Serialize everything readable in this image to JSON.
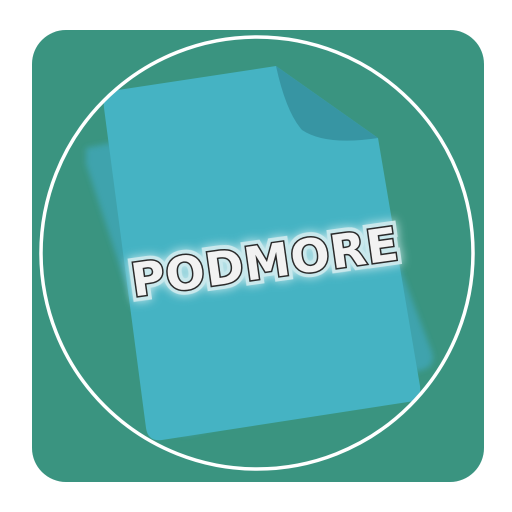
{
  "app": {
    "name": "PODMORE"
  },
  "icon": {
    "semantic": "document-file-icon",
    "colors": {
      "tile": "#3A9480",
      "ring": "#FFFFFF",
      "document": "#45B3C3",
      "document_shadow": "#3FA6B5",
      "fold": "#3795A3",
      "text_fill": "#F2F2F2",
      "text_outline": "#2A2A2A",
      "text_glow": "#D8EEF1"
    }
  }
}
